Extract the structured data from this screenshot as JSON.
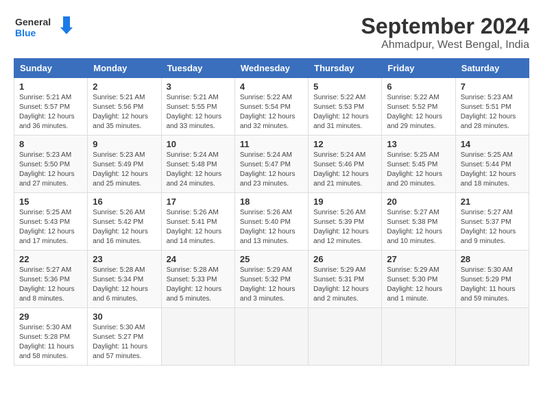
{
  "header": {
    "logo_line1": "General",
    "logo_line2": "Blue",
    "month": "September 2024",
    "location": "Ahmadpur, West Bengal, India"
  },
  "weekdays": [
    "Sunday",
    "Monday",
    "Tuesday",
    "Wednesday",
    "Thursday",
    "Friday",
    "Saturday"
  ],
  "weeks": [
    [
      {
        "day": "1",
        "info": "Sunrise: 5:21 AM\nSunset: 5:57 PM\nDaylight: 12 hours\nand 36 minutes."
      },
      {
        "day": "2",
        "info": "Sunrise: 5:21 AM\nSunset: 5:56 PM\nDaylight: 12 hours\nand 35 minutes."
      },
      {
        "day": "3",
        "info": "Sunrise: 5:21 AM\nSunset: 5:55 PM\nDaylight: 12 hours\nand 33 minutes."
      },
      {
        "day": "4",
        "info": "Sunrise: 5:22 AM\nSunset: 5:54 PM\nDaylight: 12 hours\nand 32 minutes."
      },
      {
        "day": "5",
        "info": "Sunrise: 5:22 AM\nSunset: 5:53 PM\nDaylight: 12 hours\nand 31 minutes."
      },
      {
        "day": "6",
        "info": "Sunrise: 5:22 AM\nSunset: 5:52 PM\nDaylight: 12 hours\nand 29 minutes."
      },
      {
        "day": "7",
        "info": "Sunrise: 5:23 AM\nSunset: 5:51 PM\nDaylight: 12 hours\nand 28 minutes."
      }
    ],
    [
      {
        "day": "8",
        "info": "Sunrise: 5:23 AM\nSunset: 5:50 PM\nDaylight: 12 hours\nand 27 minutes."
      },
      {
        "day": "9",
        "info": "Sunrise: 5:23 AM\nSunset: 5:49 PM\nDaylight: 12 hours\nand 25 minutes."
      },
      {
        "day": "10",
        "info": "Sunrise: 5:24 AM\nSunset: 5:48 PM\nDaylight: 12 hours\nand 24 minutes."
      },
      {
        "day": "11",
        "info": "Sunrise: 5:24 AM\nSunset: 5:47 PM\nDaylight: 12 hours\nand 23 minutes."
      },
      {
        "day": "12",
        "info": "Sunrise: 5:24 AM\nSunset: 5:46 PM\nDaylight: 12 hours\nand 21 minutes."
      },
      {
        "day": "13",
        "info": "Sunrise: 5:25 AM\nSunset: 5:45 PM\nDaylight: 12 hours\nand 20 minutes."
      },
      {
        "day": "14",
        "info": "Sunrise: 5:25 AM\nSunset: 5:44 PM\nDaylight: 12 hours\nand 18 minutes."
      }
    ],
    [
      {
        "day": "15",
        "info": "Sunrise: 5:25 AM\nSunset: 5:43 PM\nDaylight: 12 hours\nand 17 minutes."
      },
      {
        "day": "16",
        "info": "Sunrise: 5:26 AM\nSunset: 5:42 PM\nDaylight: 12 hours\nand 16 minutes."
      },
      {
        "day": "17",
        "info": "Sunrise: 5:26 AM\nSunset: 5:41 PM\nDaylight: 12 hours\nand 14 minutes."
      },
      {
        "day": "18",
        "info": "Sunrise: 5:26 AM\nSunset: 5:40 PM\nDaylight: 12 hours\nand 13 minutes."
      },
      {
        "day": "19",
        "info": "Sunrise: 5:26 AM\nSunset: 5:39 PM\nDaylight: 12 hours\nand 12 minutes."
      },
      {
        "day": "20",
        "info": "Sunrise: 5:27 AM\nSunset: 5:38 PM\nDaylight: 12 hours\nand 10 minutes."
      },
      {
        "day": "21",
        "info": "Sunrise: 5:27 AM\nSunset: 5:37 PM\nDaylight: 12 hours\nand 9 minutes."
      }
    ],
    [
      {
        "day": "22",
        "info": "Sunrise: 5:27 AM\nSunset: 5:36 PM\nDaylight: 12 hours\nand 8 minutes."
      },
      {
        "day": "23",
        "info": "Sunrise: 5:28 AM\nSunset: 5:34 PM\nDaylight: 12 hours\nand 6 minutes."
      },
      {
        "day": "24",
        "info": "Sunrise: 5:28 AM\nSunset: 5:33 PM\nDaylight: 12 hours\nand 5 minutes."
      },
      {
        "day": "25",
        "info": "Sunrise: 5:29 AM\nSunset: 5:32 PM\nDaylight: 12 hours\nand 3 minutes."
      },
      {
        "day": "26",
        "info": "Sunrise: 5:29 AM\nSunset: 5:31 PM\nDaylight: 12 hours\nand 2 minutes."
      },
      {
        "day": "27",
        "info": "Sunrise: 5:29 AM\nSunset: 5:30 PM\nDaylight: 12 hours\nand 1 minute."
      },
      {
        "day": "28",
        "info": "Sunrise: 5:30 AM\nSunset: 5:29 PM\nDaylight: 11 hours\nand 59 minutes."
      }
    ],
    [
      {
        "day": "29",
        "info": "Sunrise: 5:30 AM\nSunset: 5:28 PM\nDaylight: 11 hours\nand 58 minutes."
      },
      {
        "day": "30",
        "info": "Sunrise: 5:30 AM\nSunset: 5:27 PM\nDaylight: 11 hours\nand 57 minutes."
      },
      {
        "day": "",
        "info": ""
      },
      {
        "day": "",
        "info": ""
      },
      {
        "day": "",
        "info": ""
      },
      {
        "day": "",
        "info": ""
      },
      {
        "day": "",
        "info": ""
      }
    ]
  ]
}
